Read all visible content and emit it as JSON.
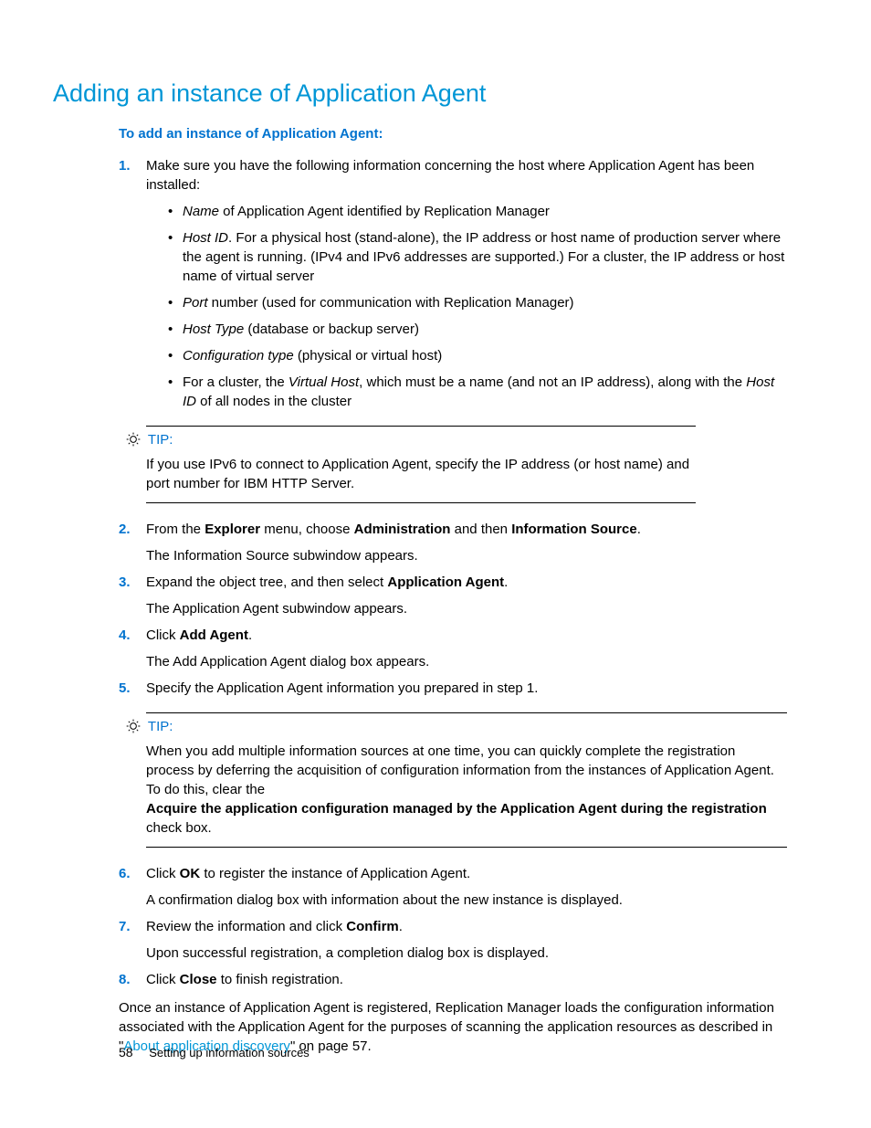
{
  "title": "Adding an instance of Application Agent",
  "intro": "To add an instance of Application Agent:",
  "steps": {
    "s1": {
      "num": "1.",
      "text": "Make sure you have the following information concerning the host where Application Agent has been installed:"
    },
    "s2": {
      "num": "2.",
      "text_a": "From the ",
      "b1": "Explorer",
      "text_b": " menu, choose ",
      "b2": "Administration",
      "text_c": " and then ",
      "b3": "Information Source",
      "text_d": ".",
      "sub": "The Information Source subwindow appears."
    },
    "s3": {
      "num": "3.",
      "text_a": "Expand the object tree, and then select ",
      "b1": "Application Agent",
      "text_b": ".",
      "sub": "The Application Agent subwindow appears."
    },
    "s4": {
      "num": "4.",
      "text_a": "Click ",
      "b1": "Add Agent",
      "text_b": ".",
      "sub": "The Add Application Agent dialog box appears."
    },
    "s5": {
      "num": "5.",
      "text": "Specify the Application Agent information you prepared in step 1."
    },
    "s6": {
      "num": "6.",
      "text_a": "Click ",
      "b1": "OK",
      "text_b": " to register the instance of Application Agent.",
      "sub": "A confirmation dialog box with information about the new instance is displayed."
    },
    "s7": {
      "num": "7.",
      "text_a": "Review the information and click ",
      "b1": "Confirm",
      "text_b": ".",
      "sub": "Upon successful registration, a completion dialog box is displayed."
    },
    "s8": {
      "num": "8.",
      "text_a": "Click ",
      "b1": "Close",
      "text_b": " to finish registration."
    }
  },
  "sublist": {
    "i1": {
      "em": "Name",
      "rest": " of Application Agent identified by Replication Manager"
    },
    "i2": {
      "em": "Host ID",
      "rest": ". For a physical host (stand-alone), the IP address or host name of production server where the agent is running. (IPv4 and IPv6 addresses are supported.) For a cluster, the IP address or host name of virtual server"
    },
    "i3": {
      "em": "Port",
      "rest": " number (used for communication with Replication Manager)"
    },
    "i4": {
      "em": "Host Type",
      "rest": " (database or backup server)"
    },
    "i5": {
      "em": "Configuration type",
      "rest": " (physical or virtual host)"
    },
    "i6": {
      "pre": "For a cluster, the ",
      "em1": "Virtual Host",
      "mid": ", which must be a name (and not an IP address), along with the ",
      "em2": "Host ID",
      "post": " of all nodes in the cluster"
    }
  },
  "tip1": {
    "label": "TIP:",
    "body": "If you use IPv6 to connect to Application Agent, specify the IP address (or host name) and port number for IBM HTTP Server."
  },
  "tip2": {
    "label": "TIP:",
    "body_a": "When you add multiple information sources at one time, you can quickly complete the registration process by deferring the acquisition of configuration information from the instances of Application Agent. To do this, clear the",
    "bold": "Acquire the application configuration managed by the Application Agent during the registration",
    "body_b": "check box."
  },
  "closing": {
    "pre": "Once an instance of Application Agent is registered, Replication Manager loads the configuration information associated with the Application Agent for the purposes of scanning the application resources as described in \"",
    "link": "About application discovery",
    "post": "\" on page 57."
  },
  "footer": {
    "page": "58",
    "section": "Setting up information sources"
  }
}
